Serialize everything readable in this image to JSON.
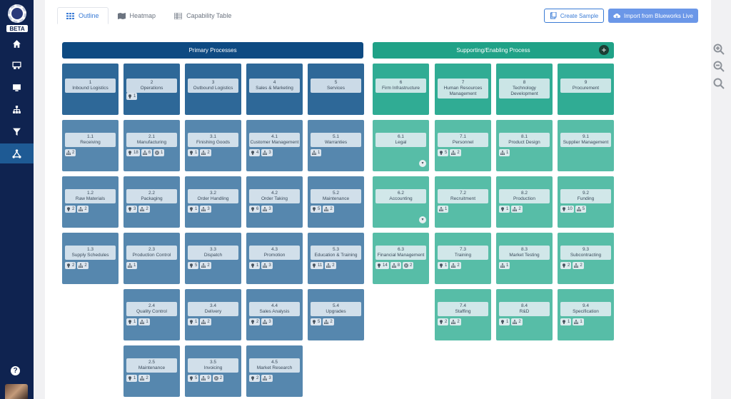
{
  "sidebar": {
    "logo_text": "BETA",
    "nav": [
      {
        "icon": "home-icon"
      },
      {
        "icon": "presentation-icon"
      },
      {
        "icon": "monitor-icon"
      },
      {
        "icon": "hierarchy-icon"
      },
      {
        "icon": "filter-icon"
      },
      {
        "icon": "network-icon",
        "active": true
      }
    ],
    "help_label": "?"
  },
  "tabs": [
    {
      "label": "Outline",
      "icon": "grid-icon",
      "active": true
    },
    {
      "label": "Heatmap",
      "icon": "map-icon"
    },
    {
      "label": "Capability Table",
      "icon": "table-icon"
    }
  ],
  "actions": {
    "create_sample": "Create Sample",
    "import": "Import from Blueworks Live"
  },
  "groups": {
    "primary": "Primary Processes",
    "supporting": "Supporting/Enabling Process",
    "add_label": "+"
  },
  "columns": [
    {
      "group": "primary",
      "items": [
        {
          "num": "1",
          "name": "Inbound Logistics"
        },
        {
          "num": "1.1",
          "name": "Receiving",
          "badges": [
            {
              "icon": "hierarchy",
              "count": "2"
            }
          ]
        },
        {
          "num": "1.2",
          "name": "Raw Materials",
          "badges": [
            {
              "icon": "bulb",
              "count": "2"
            },
            {
              "icon": "hierarchy",
              "count": "2"
            }
          ]
        },
        {
          "num": "1.3",
          "name": "Supply Schedules",
          "badges": [
            {
              "icon": "bulb",
              "count": "2"
            },
            {
              "icon": "hierarchy",
              "count": "2"
            }
          ]
        }
      ]
    },
    {
      "group": "primary",
      "items": [
        {
          "num": "2",
          "name": "Operations",
          "badges": [
            {
              "icon": "bulb",
              "count": "1"
            }
          ]
        },
        {
          "num": "2.1",
          "name": "Manufacturing",
          "badges": [
            {
              "icon": "bulb",
              "count": "18"
            },
            {
              "icon": "hierarchy",
              "count": "6"
            },
            {
              "icon": "target",
              "count": "1"
            }
          ]
        },
        {
          "num": "2.2",
          "name": "Packaging",
          "badges": [
            {
              "icon": "bulb",
              "count": "3"
            },
            {
              "icon": "hierarchy",
              "count": "2"
            }
          ]
        },
        {
          "num": "2.3",
          "name": "Production Control",
          "badges": [
            {
              "icon": "hierarchy",
              "count": "1"
            }
          ]
        },
        {
          "num": "2.4",
          "name": "Quality Control",
          "badges": [
            {
              "icon": "bulb",
              "count": "1"
            },
            {
              "icon": "hierarchy",
              "count": "1"
            }
          ]
        },
        {
          "num": "2.5",
          "name": "Maintenance",
          "badges": [
            {
              "icon": "bulb",
              "count": "1"
            },
            {
              "icon": "hierarchy",
              "count": "2"
            }
          ]
        }
      ]
    },
    {
      "group": "primary",
      "items": [
        {
          "num": "3",
          "name": "Outbound Logistics"
        },
        {
          "num": "3.1",
          "name": "Finishing Goods",
          "badges": [
            {
              "icon": "bulb",
              "count": "1"
            },
            {
              "icon": "hierarchy",
              "count": "2"
            }
          ]
        },
        {
          "num": "3.2",
          "name": "Order Handling",
          "badges": [
            {
              "icon": "bulb",
              "count": "1"
            },
            {
              "icon": "hierarchy",
              "count": "3"
            }
          ]
        },
        {
          "num": "3.3",
          "name": "Dispatch",
          "badges": [
            {
              "icon": "bulb",
              "count": "5"
            },
            {
              "icon": "hierarchy",
              "count": "2"
            }
          ]
        },
        {
          "num": "3.4",
          "name": "Delivery",
          "badges": [
            {
              "icon": "bulb",
              "count": "1"
            },
            {
              "icon": "hierarchy",
              "count": "2"
            }
          ]
        },
        {
          "num": "3.5",
          "name": "Invoicing",
          "badges": [
            {
              "icon": "bulb",
              "count": "5"
            },
            {
              "icon": "hierarchy",
              "count": "9"
            },
            {
              "icon": "target",
              "count": "2"
            }
          ]
        }
      ]
    },
    {
      "group": "primary",
      "items": [
        {
          "num": "4",
          "name": "Sales & Marketing"
        },
        {
          "num": "4.1",
          "name": "Customer Management",
          "badges": [
            {
              "icon": "bulb",
              "count": "4"
            },
            {
              "icon": "hierarchy",
              "count": "3"
            }
          ]
        },
        {
          "num": "4.2",
          "name": "Order Taking",
          "badges": [
            {
              "icon": "bulb",
              "count": "6"
            },
            {
              "icon": "hierarchy",
              "count": "3"
            }
          ]
        },
        {
          "num": "4.3",
          "name": "Promotion",
          "badges": [
            {
              "icon": "bulb",
              "count": "1"
            },
            {
              "icon": "hierarchy",
              "count": "3"
            }
          ]
        },
        {
          "num": "4.4",
          "name": "Sales Analysis",
          "badges": [
            {
              "icon": "bulb",
              "count": "2"
            },
            {
              "icon": "hierarchy",
              "count": "3"
            }
          ]
        },
        {
          "num": "4.5",
          "name": "Market Research",
          "badges": [
            {
              "icon": "bulb",
              "count": "2"
            },
            {
              "icon": "hierarchy",
              "count": "3"
            }
          ]
        }
      ]
    },
    {
      "group": "primary",
      "items": [
        {
          "num": "5",
          "name": "Services"
        },
        {
          "num": "5.1",
          "name": "Warranties",
          "badges": [
            {
              "icon": "hierarchy",
              "count": "1"
            }
          ]
        },
        {
          "num": "5.2",
          "name": "Maintenance",
          "badges": [
            {
              "icon": "bulb",
              "count": "5"
            },
            {
              "icon": "hierarchy",
              "count": "2"
            }
          ]
        },
        {
          "num": "5.3",
          "name": "Education & Training",
          "badges": [
            {
              "icon": "bulb",
              "count": "11"
            },
            {
              "icon": "hierarchy",
              "count": "2"
            }
          ]
        },
        {
          "num": "5.4",
          "name": "Upgrades",
          "badges": [
            {
              "icon": "bulb",
              "count": "5"
            },
            {
              "icon": "hierarchy",
              "count": "2"
            }
          ]
        }
      ]
    },
    {
      "group": "supporting",
      "items": [
        {
          "num": "6",
          "name": "Firm Infrastructure"
        },
        {
          "num": "6.1",
          "name": "Legal",
          "expand": true
        },
        {
          "num": "6.2",
          "name": "Accounting",
          "expand": true
        },
        {
          "num": "6.3",
          "name": "Financial Management",
          "badges": [
            {
              "icon": "bulb",
              "count": "14"
            },
            {
              "icon": "hierarchy",
              "count": "8"
            },
            {
              "icon": "target",
              "count": "2"
            }
          ]
        }
      ]
    },
    {
      "group": "supporting",
      "items": [
        {
          "num": "7",
          "name": "Human Resources Management"
        },
        {
          "num": "7.1",
          "name": "Personnel",
          "badges": [
            {
              "icon": "bulb",
              "count": "5"
            },
            {
              "icon": "hierarchy",
              "count": "2"
            }
          ]
        },
        {
          "num": "7.2",
          "name": "Recruitment",
          "badges": [
            {
              "icon": "hierarchy",
              "count": "1"
            }
          ]
        },
        {
          "num": "7.3",
          "name": "Training",
          "badges": [
            {
              "icon": "bulb",
              "count": "1"
            },
            {
              "icon": "hierarchy",
              "count": "2"
            }
          ]
        },
        {
          "num": "7.4",
          "name": "Staffing",
          "badges": [
            {
              "icon": "bulb",
              "count": "2"
            },
            {
              "icon": "hierarchy",
              "count": "2"
            }
          ]
        }
      ]
    },
    {
      "group": "supporting",
      "items": [
        {
          "num": "8",
          "name": "Technology Development"
        },
        {
          "num": "8.1",
          "name": "Product Design",
          "badges": [
            {
              "icon": "hierarchy",
              "count": "1"
            }
          ]
        },
        {
          "num": "8.2",
          "name": "Production",
          "badges": [
            {
              "icon": "bulb",
              "count": "1"
            },
            {
              "icon": "hierarchy",
              "count": "2"
            }
          ]
        },
        {
          "num": "8.3",
          "name": "Market Testing",
          "badges": [
            {
              "icon": "hierarchy",
              "count": "1"
            }
          ]
        },
        {
          "num": "8.4",
          "name": "R&D",
          "badges": [
            {
              "icon": "bulb",
              "count": "1"
            },
            {
              "icon": "hierarchy",
              "count": "2"
            }
          ]
        }
      ]
    },
    {
      "group": "supporting",
      "items": [
        {
          "num": "9",
          "name": "Procurement"
        },
        {
          "num": "9.1",
          "name": "Supplier Management"
        },
        {
          "num": "9.2",
          "name": "Funding",
          "badges": [
            {
              "icon": "bulb",
              "count": "10"
            },
            {
              "icon": "hierarchy",
              "count": "5"
            }
          ]
        },
        {
          "num": "9.3",
          "name": "Subcontracting",
          "badges": [
            {
              "icon": "bulb",
              "count": "2"
            },
            {
              "icon": "hierarchy",
              "count": "2"
            }
          ]
        },
        {
          "num": "9.4",
          "name": "Specification",
          "badges": [
            {
              "icon": "bulb",
              "count": "1"
            },
            {
              "icon": "hierarchy",
              "count": "1"
            }
          ]
        }
      ]
    }
  ],
  "zoom_tools": [
    {
      "icon": "zoom-in-icon"
    },
    {
      "icon": "zoom-out-icon"
    },
    {
      "icon": "search-icon"
    }
  ]
}
